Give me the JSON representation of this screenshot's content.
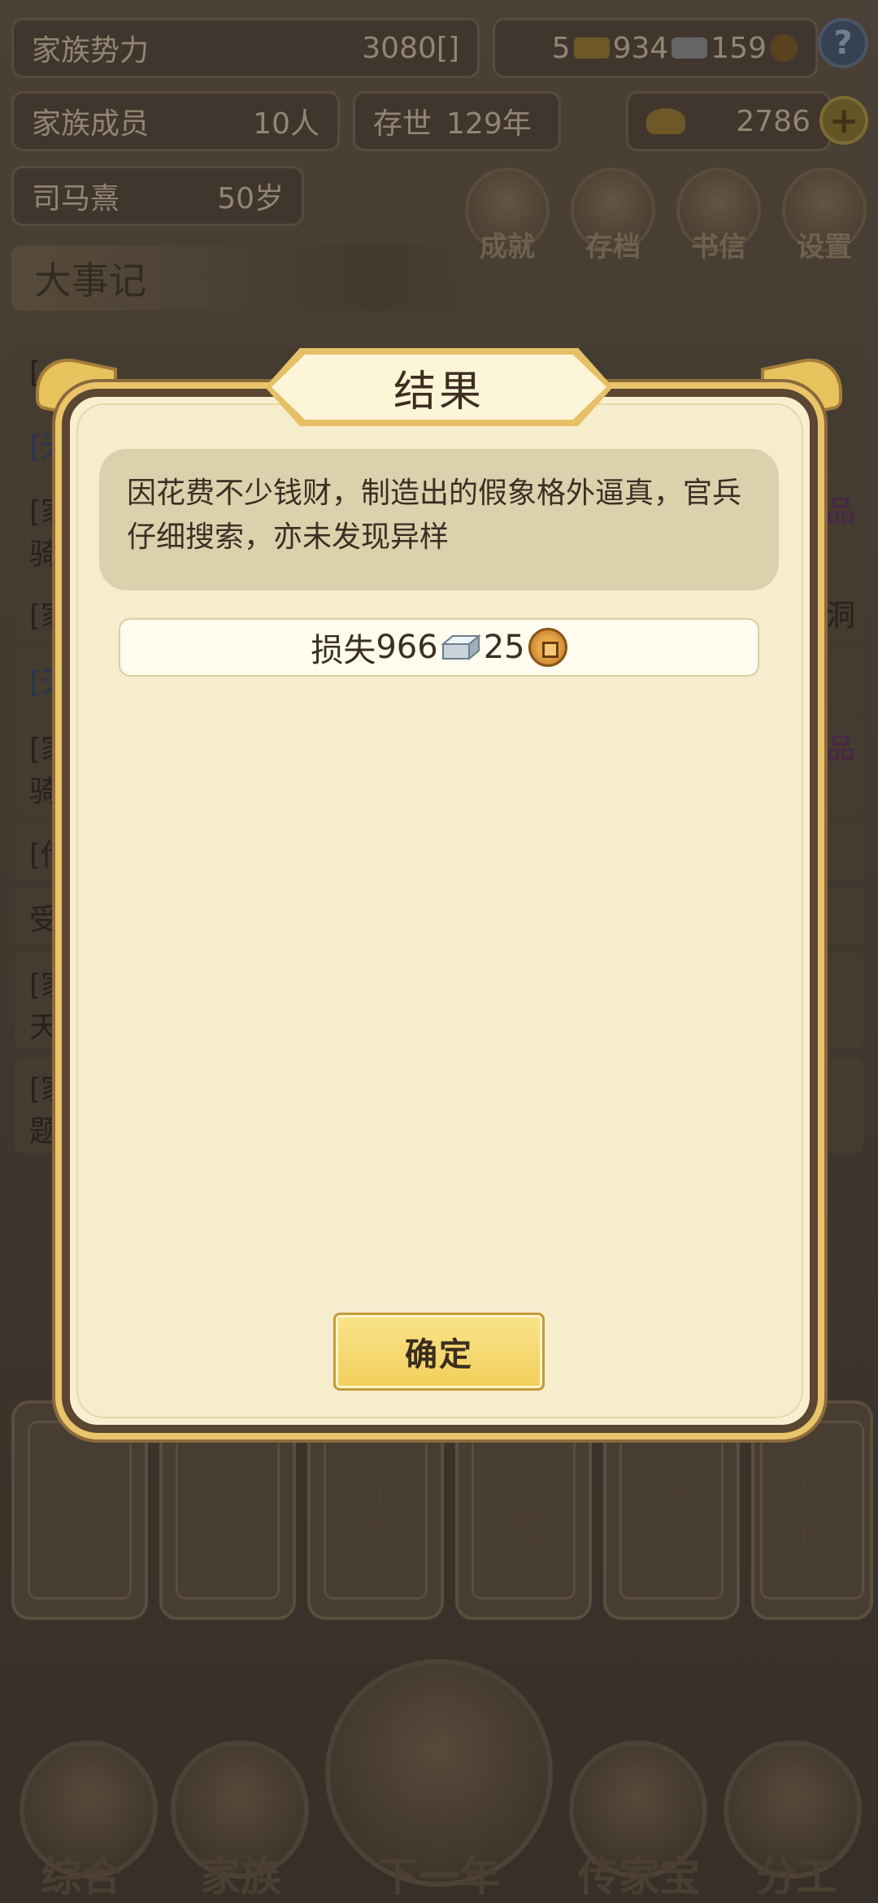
{
  "top_bar": {
    "power_label": "家族势力",
    "power_value": "3080",
    "power_rank": "",
    "gold_count": "5",
    "silver_count": "934",
    "coin_count": "159",
    "help_icon": "?",
    "members_label": "家族成员",
    "members_value": "10人",
    "existed_label": "存世",
    "existed_value": "129年",
    "yuanbao_value": "2786",
    "add_icon": "+",
    "patriarch_name": "司马熹",
    "patriarch_age": "50岁"
  },
  "menu_buttons": [
    {
      "label": "成就",
      "icon": "achievement-icon"
    },
    {
      "label": "存档",
      "icon": "save-icon"
    },
    {
      "label": "书信",
      "icon": "letter-icon"
    },
    {
      "label": "设置",
      "icon": "settings-icon"
    }
  ],
  "events_title": "大事记",
  "event_rows": [
    {
      "text": "[",
      "right": ""
    },
    {
      "text": "[天",
      "right": ""
    },
    {
      "text": "[家\n骑",
      "right": "品"
    },
    {
      "text": "[家",
      "right": "洞"
    },
    {
      "text": "[天",
      "right": ""
    },
    {
      "text": "[家\n骑",
      "right": "品"
    },
    {
      "text": "[传",
      "right": ""
    },
    {
      "text": "受",
      "right": ""
    },
    {
      "text": "[家\n天",
      "right": ""
    },
    {
      "text": "[家\n题",
      "right": ""
    }
  ],
  "building_tiles": [
    "药园",
    "宗祠",
    "市场",
    "议事",
    "家风",
    "风俗"
  ],
  "bottom_nav": [
    "综合",
    "家族",
    "下一年",
    "传家宝",
    "分工"
  ],
  "dialog": {
    "title": "结果",
    "message": "因花费不少钱财，制造出的假象格外逼真，官兵仔细搜索，亦未发现异样",
    "loss_label": "损失",
    "loss_silver": "966",
    "loss_coins": "25",
    "confirm_label": "确定"
  },
  "colors": {
    "dialog_bg": "#f6edcc",
    "frame_gold": "#e9c46a",
    "frame_dark": "#5b4631",
    "button_gold": "#f2cf5c"
  }
}
